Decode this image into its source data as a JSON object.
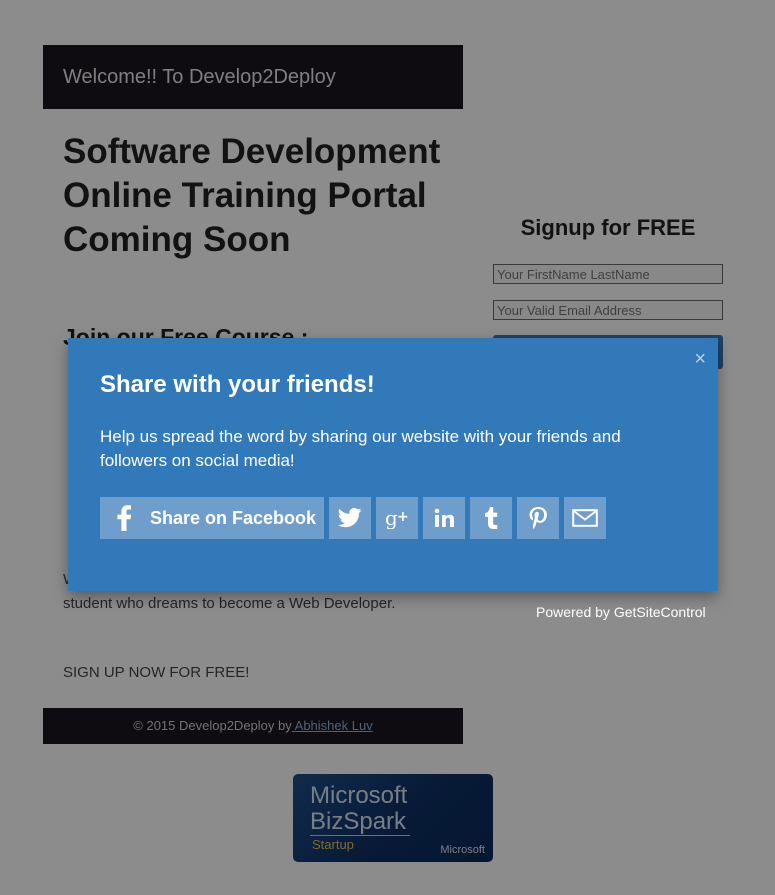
{
  "header": {
    "title": "Welcome!! To Develop2Deploy"
  },
  "main": {
    "headline": "Software Development Online Training Portal Coming Soon",
    "subhead": "Join our Free Course :",
    "paragraph_a": "",
    "paragraph_b": "",
    "paragraph_c": "Web Developer will be the ONE-STOP Guide for every student who dreams to become a Web Developer.",
    "signup_now": "SIGN UP NOW FOR FREE!"
  },
  "footer": {
    "copyright": "© 2015 Develop2Deploy by",
    "author_link": " Abhishek Luv"
  },
  "signup_form": {
    "title": "Signup for FREE",
    "name_placeholder": "Your FirstName LastName",
    "email_placeholder": "Your Valid Email Address",
    "powered_by": "Powered by GetSiteControl"
  },
  "badge": {
    "line1": "Microsoft",
    "line2": "BizSpark",
    "line3": "Startup",
    "corner": "Microsoft"
  },
  "share_modal": {
    "title": "Share with your friends!",
    "text": "Help us spread the word by sharing our website with your friends and followers on social media!",
    "facebook_label": "Share on Facebook",
    "close_glyph": "×",
    "icons": [
      "facebook-icon",
      "twitter-icon",
      "google-plus-icon",
      "linkedin-icon",
      "tumblr-icon",
      "pinterest-icon",
      "email-icon"
    ]
  },
  "colors": {
    "modal_bg": "#3279b9",
    "share_button_bg": "#6f9dcc",
    "header_bg": "#1c1620",
    "page_backdrop": "#8f8f8f"
  }
}
